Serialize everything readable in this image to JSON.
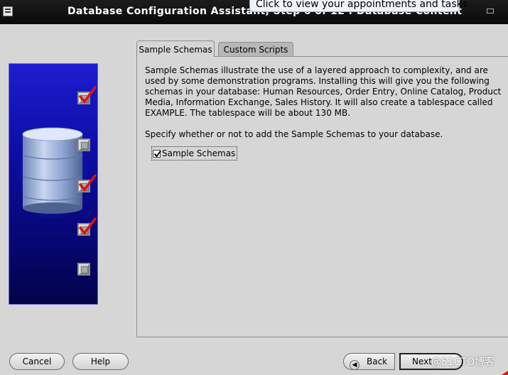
{
  "window": {
    "title": "Database Configuration Assistant, Step 6 of 12 : Database Content",
    "tooltip": "Click to view your appointments and tasks"
  },
  "tabs": [
    {
      "label": "Sample Schemas",
      "active": true
    },
    {
      "label": "Custom Scripts",
      "active": false
    }
  ],
  "content": {
    "description": "Sample Schemas illustrate the use of a layered approach to complexity, and are used by some demonstration programs. Installing this will give you the following schemas in your database: Human Resources, Order Entry, Online Catalog, Product Media, Information Exchange, Sales History. It will also create a tablespace called EXAMPLE. The tablespace will be about 130 MB.",
    "prompt": "Specify whether or not to add the Sample Schemas to your database.",
    "checkbox_label": "Sample Schemas",
    "checkbox_checked": true
  },
  "wizard_steps": [
    {
      "checked": true
    },
    {
      "checked": false
    },
    {
      "checked": true
    },
    {
      "checked": true
    },
    {
      "checked": false
    }
  ],
  "buttons": {
    "cancel": "Cancel",
    "help": "Help",
    "back": "Back",
    "next": "Next"
  },
  "watermark": "@51CTO博客",
  "colors": {
    "panel_top": "#1d1dcf",
    "panel_bottom": "#03034a",
    "check_red": "#e01010",
    "titlebar": "#111111"
  }
}
